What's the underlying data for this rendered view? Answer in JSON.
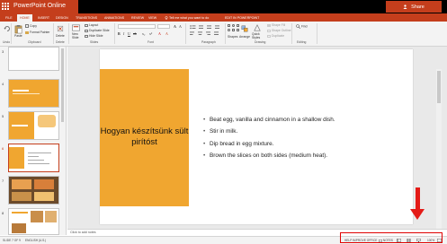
{
  "app": {
    "title": "PowerPoint Online",
    "share_label": "Share"
  },
  "tabs": [
    "FILE",
    "HOME",
    "INSERT",
    "DESIGN",
    "TRANSITIONS",
    "ANIMATIONS",
    "REVIEW",
    "VIEW"
  ],
  "active_tab": "HOME",
  "tell_me": "Tell me what you want to do",
  "edit_in_app": "EDIT IN POWERPOINT",
  "ribbon": {
    "undo_label": "Undo",
    "paste_label": "Paste",
    "copy_label": "Copy",
    "format_painter_label": "Format Painter",
    "delete_label": "Delete",
    "new_slide_label": "New Slide",
    "layout_label": "Layout",
    "duplicate_slide_label": "Duplicate Slide",
    "hide_slide_label": "Hide Slide",
    "shapes_label": "Shapes",
    "arrange_label": "Arrange",
    "quick_styles_label": "Quick Styles",
    "shape_fill_label": "Shape Fill",
    "shape_outline_label": "Shape Outline",
    "duplicate_label": "Duplicate",
    "find_label": "Find",
    "groups": {
      "clipboard": "Clipboard",
      "delete": "Delete",
      "slides": "Slides",
      "font": "Font",
      "paragraph": "Paragraph",
      "drawing": "Drawing",
      "editing": "Editing"
    }
  },
  "slides": {
    "numbers": [
      "3",
      "4",
      "5",
      "6",
      "7",
      "8",
      "9"
    ],
    "selected": "7"
  },
  "current_slide": {
    "title": "Hogyan készítsünk sült pirítóst",
    "bullets": [
      "Beat egg, vanilla and cinnamon in a shallow dish.",
      "Stir in milk.",
      "Dip bread in egg mixture.",
      "Brown the slices on both sides (medium heat)."
    ]
  },
  "notes_placeholder": "Click to add notes",
  "status": {
    "slide_info": "SLIDE 7 OF 9",
    "language": "ENGLISH (U.S.)",
    "help_improve": "HELP IMPROVE OFFICE",
    "notes_label": "NOTES",
    "zoom": "100%"
  },
  "colors": {
    "brand": "#c43e1c",
    "slide_accent": "#f0a630",
    "annotation": "#e41b17"
  }
}
